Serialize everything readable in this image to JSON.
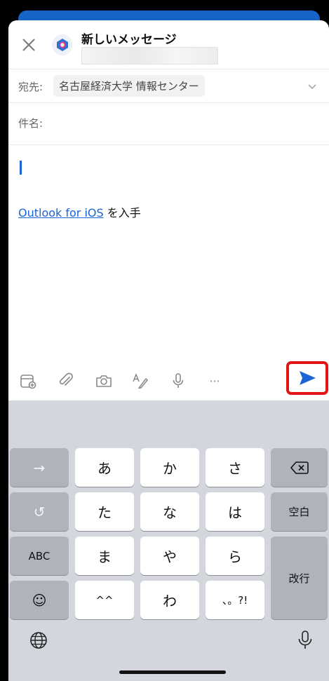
{
  "compose": {
    "title": "新しいメッセージ",
    "to_label": "宛先:",
    "to_recipient": "名古屋経済大学 情報センター",
    "subject_label": "件名:",
    "signature_link": "Outlook for iOS",
    "signature_suffix": " を入手"
  },
  "toolbar": {
    "icons": [
      "add-calendar-icon",
      "attach-icon",
      "camera-icon",
      "format-text-icon",
      "dictation-icon",
      "more-icon",
      "send-icon"
    ],
    "more_label": "···"
  },
  "keyboard": {
    "row1": [
      "→",
      "あ",
      "か",
      "さ",
      "⌫"
    ],
    "row2": [
      "↺",
      "た",
      "な",
      "は",
      "空白"
    ],
    "row3": [
      "ABC",
      "ま",
      "や",
      "ら",
      "改行"
    ],
    "row4": [
      "☺",
      "^^",
      "わ",
      "、。?!"
    ]
  },
  "colors": {
    "accent": "#1a64d8",
    "highlight_box": "#e01616",
    "keyboard_bg": "#d3d6dc"
  }
}
